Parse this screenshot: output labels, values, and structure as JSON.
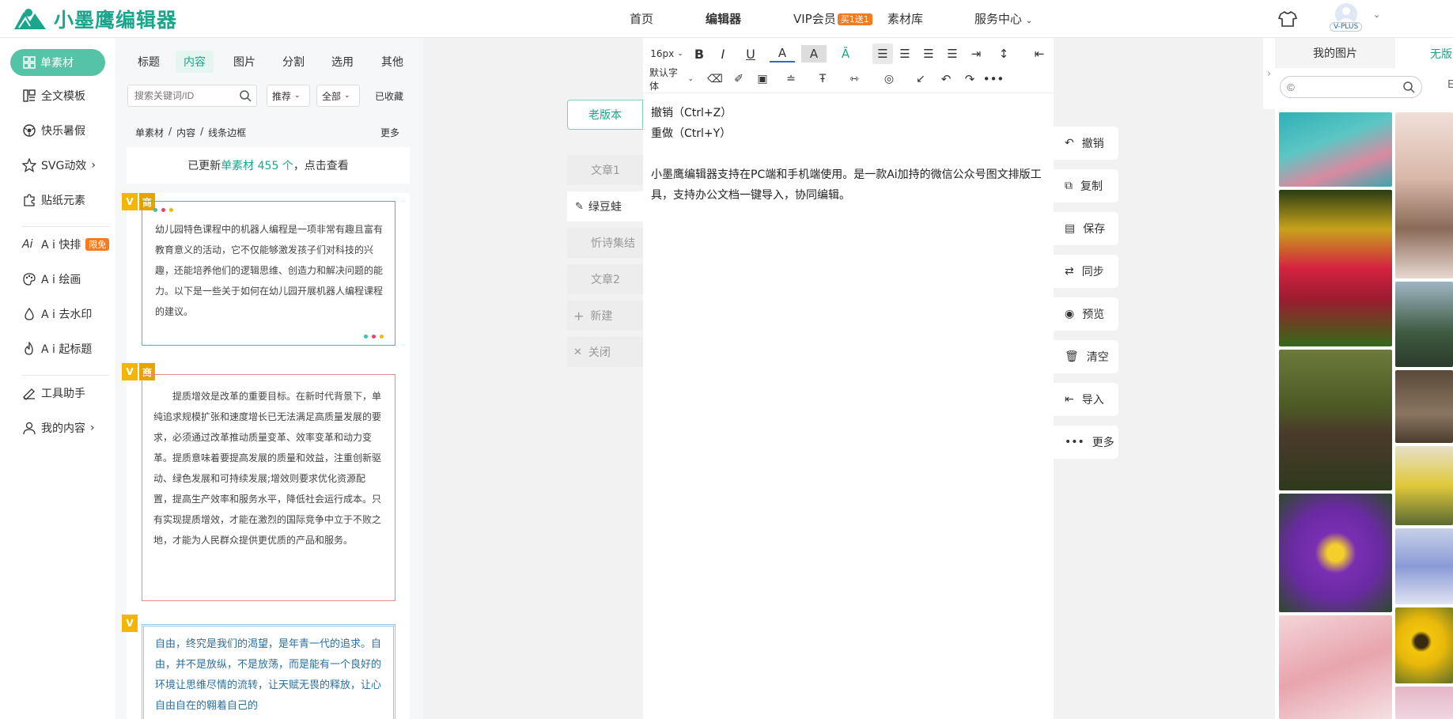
{
  "header": {
    "logo_text": "小墨鹰编辑器",
    "nav": [
      {
        "label": "首页",
        "active": false
      },
      {
        "label": "编辑器",
        "active": true
      },
      {
        "label": "VIP会员",
        "badge": "买1送1"
      },
      {
        "label": "素材库"
      },
      {
        "label": "服务中心"
      }
    ],
    "vip_label": "V-PLUS"
  },
  "leftnav": {
    "items": [
      {
        "label": "单素材",
        "icon": "grid-icon"
      },
      {
        "label": "全文模板",
        "icon": "template-icon"
      },
      {
        "label": "快乐暑假",
        "icon": "ball-icon"
      },
      {
        "label": "SVG动效",
        "icon": "star-icon"
      },
      {
        "label": "贴纸元素",
        "icon": "puzzle-icon"
      },
      {
        "label": "A i 快排",
        "icon": "ai-icon",
        "badge": "限免"
      },
      {
        "label": "A i 绘画",
        "icon": "palette-icon"
      },
      {
        "label": "A i 去水印",
        "icon": "drop-icon"
      },
      {
        "label": "A i 起标题",
        "icon": "flame-icon"
      },
      {
        "label": "工具助手",
        "icon": "tool-icon"
      },
      {
        "label": "我的内容",
        "icon": "user-icon"
      }
    ]
  },
  "materials": {
    "tabs": [
      "标题",
      "内容",
      "图片",
      "分割",
      "选用",
      "其他"
    ],
    "search_placeholder": "搜索关键词/ID",
    "filter_sort": "推荐",
    "filter_scope": "全部",
    "saved": "已收藏",
    "breadcrumb": [
      "单素材",
      "内容",
      "线条边框"
    ],
    "more": "更多",
    "update_prefix": "已更新",
    "update_link": "单素材 455 个",
    "update_suffix": "，点击查看",
    "flag_v": "V",
    "flag_shang": "商",
    "card1_text": "幼儿园特色课程中的机器人编程是一项非常有趣且富有教育意义的活动，它不仅能够激发孩子们对科技的兴趣，还能培养他们的逻辑思维、创造力和解决问题的能力。以下是一些关于如何在幼儿园开展机器人编程课程的建议。",
    "card2_text": "提质增效是改革的重要目标。在新时代背景下，单纯追求规模扩张和速度增长已无法满足高质量发展的要求，必须通过改革推动质量变革、效率变革和动力变革。提质意味着要提高发展的质量和效益，注重创新驱动、绿色发展和可持续发展;增效则要求优化资源配置，提高生产效率和服务水平，降低社会运行成本。只有实现提质增效，才能在激烈的国际竞争中立于不败之地，才能为人民群众提供更优质的产品和服务。",
    "card3_text": "自由，终究是我们的渴望，是年青一代的追求。自由，并不是放纵，不是放荡，而是能有一个良好的环境让思维尽情的流转，让天赋无畏的释放，让心自由自在的翱着自己的"
  },
  "docs": {
    "old_version": "老版本",
    "items": [
      "文章1",
      "绿豆蛙",
      "忻诗集结",
      "文章2"
    ],
    "new": "新建",
    "close": "关闭"
  },
  "editor": {
    "font_size": "16px",
    "font_family": "默认字体",
    "lines": [
      "撤销（Ctrl+Z）",
      "重做（Ctrl+Y）",
      "小墨鹰编辑器支持在PC端和手机端使用。是一款Ai加持的微信公众号图文排版工具，支持办公文档一键导入，协同编辑。"
    ]
  },
  "actions": [
    "撤销",
    "复制",
    "保存",
    "同步",
    "预览",
    "清空",
    "导入",
    "更多"
  ],
  "right": {
    "tabs": [
      "我的图片",
      "无版"
    ],
    "search_placeholder": "©"
  },
  "colors": {
    "accent": "#1aa58c",
    "accent_light": "#55c4a6",
    "badge": "#f47b20"
  }
}
